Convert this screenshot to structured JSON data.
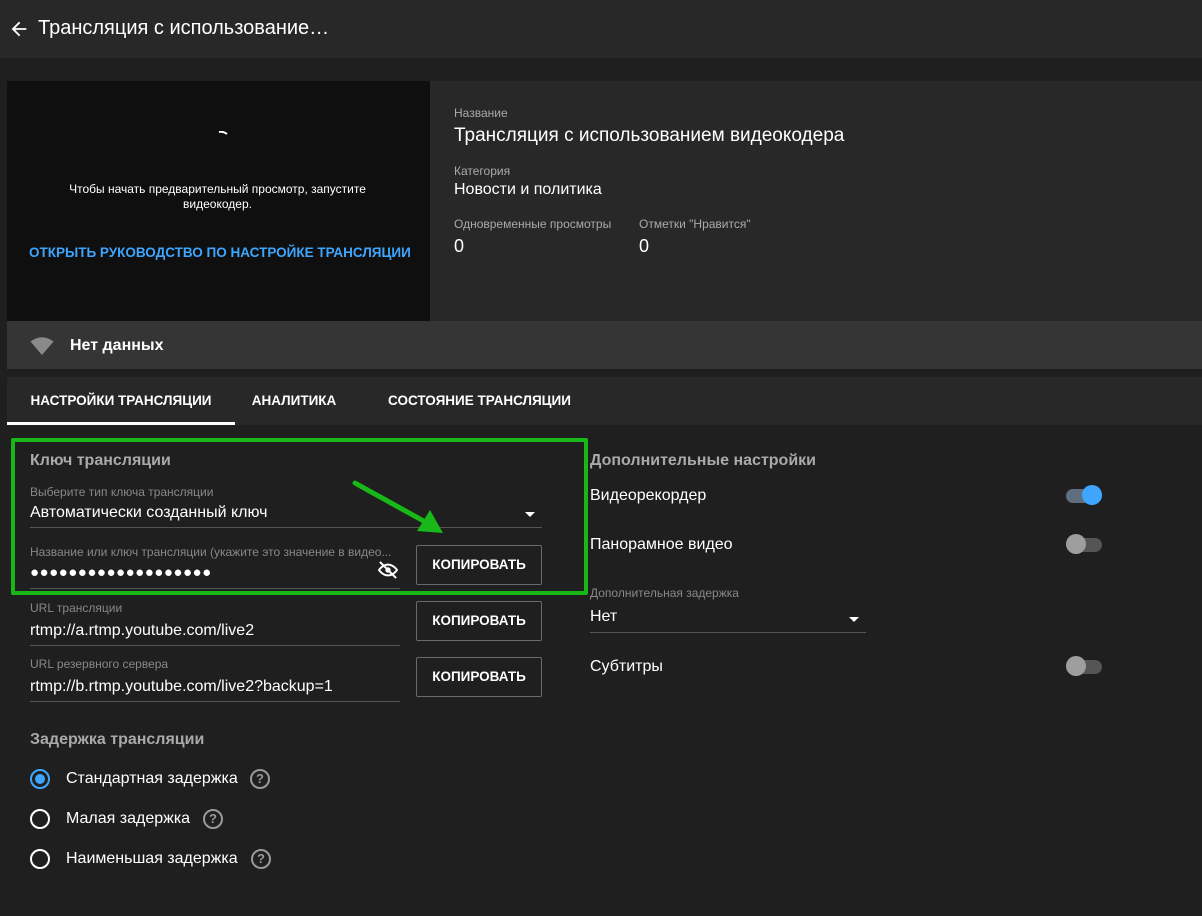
{
  "header": {
    "title": "Трансляция с использование…"
  },
  "preview": {
    "message": "Чтобы начать предварительный просмотр, запустите видеокодер.",
    "guide_link": "ОТКРЫТЬ РУКОВОДСТВО ПО НАСТРОЙКЕ ТРАНСЛЯЦИИ"
  },
  "info": {
    "name_label": "Название",
    "name_value": "Трансляция с использованием видеокодера",
    "category_label": "Категория",
    "category_value": "Новости и политика",
    "concurrent_label": "Одновременные просмотры",
    "concurrent_value": "0",
    "likes_label": "Отметки \"Нравится\"",
    "likes_value": "0"
  },
  "status": {
    "text": "Нет данных"
  },
  "tabs": [
    {
      "label": "НАСТРОЙКИ ТРАНСЛЯЦИИ",
      "active": true
    },
    {
      "label": "АНАЛИТИКА",
      "active": false
    },
    {
      "label": "СОСТОЯНИЕ ТРАНСЛЯЦИИ",
      "active": false
    }
  ],
  "stream_key": {
    "section_title": "Ключ трансляции",
    "type_label": "Выберите тип ключа трансляции",
    "type_value": "Автоматически созданный ключ",
    "key_label": "Название или ключ трансляции (укажите это значение в видео...",
    "key_value": "●●●●●●●●●●●●●●●●●●●",
    "copy_label": "КОПИРОВАТЬ"
  },
  "urls": {
    "url_label": "URL трансляции",
    "url_value": "rtmp://a.rtmp.youtube.com/live2",
    "backup_label": "URL резервного сервера",
    "backup_value": "rtmp://b.rtmp.youtube.com/live2?backup=1",
    "copy_label": "КОПИРОВАТЬ"
  },
  "latency": {
    "section_title": "Задержка трансляции",
    "options": [
      {
        "label": "Стандартная задержка",
        "selected": true
      },
      {
        "label": "Малая задержка",
        "selected": false
      },
      {
        "label": "Наименьшая задержка",
        "selected": false
      }
    ],
    "help_glyph": "?"
  },
  "additional": {
    "section_title": "Дополнительные настройки",
    "dvr_label": "Видеорекордер",
    "dvr_on": true,
    "360_label": "Панорамное видео",
    "360_on": false,
    "delay_label": "Дополнительная задержка",
    "delay_value": "Нет",
    "captions_label": "Субтитры",
    "captions_on": false
  },
  "colors": {
    "accent": "#3ea6ff",
    "highlight": "#19b819",
    "background": "#1f1f1f"
  }
}
